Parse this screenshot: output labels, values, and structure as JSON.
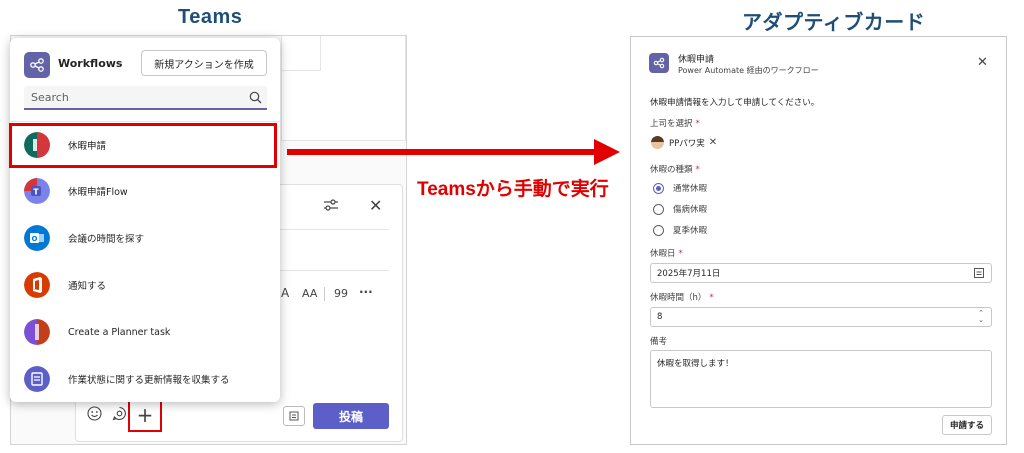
{
  "headings": {
    "teams": "Teams",
    "card": "アダプティブカード"
  },
  "arrow_label": "Teamsから手動で実行",
  "workflows": {
    "title": "Workflows",
    "new_action_label": "新規アクションを作成",
    "search_placeholder": "Search",
    "items": [
      {
        "label": "休暇申請",
        "icon": "flow-app-icon",
        "selected": true
      },
      {
        "label": "休暇申請Flow",
        "icon": "teams-app-icon"
      },
      {
        "label": "会議の時間を探す",
        "icon": "outlook-app-icon"
      },
      {
        "label": "通知する",
        "icon": "office-app-icon"
      },
      {
        "label": "Create a Planner task",
        "icon": "planner-app-icon"
      },
      {
        "label": "作業状態に関する更新情報を収集する",
        "icon": "forms-app-icon"
      }
    ]
  },
  "compose": {
    "send_label": "投稿",
    "format_aa": "AA",
    "format_quote": "99",
    "format_more": "···"
  },
  "card": {
    "title": "休暇申請",
    "subtitle": "Power Automate 経由のワークフロー",
    "intro": "休暇申請情報を入力して申請してください。",
    "manager_label": "上司を選択",
    "manager_name": "PPパワ実",
    "leave_type_label": "休暇の種類",
    "leave_types": [
      "通常休暇",
      "傷病休暇",
      "夏季休暇"
    ],
    "selected_leave_type": 0,
    "date_label": "休暇日",
    "date_value": "2025年7月11日",
    "hours_label": "休暇時間（h）",
    "hours_value": "8",
    "notes_label": "備考",
    "notes_value": "休暇を取得します！",
    "submit_label": "申請する",
    "required_mark": "*"
  },
  "colors": {
    "accent": "#5b5fc7",
    "highlight_red": "#e00000",
    "heading_blue": "#1f4e79"
  }
}
